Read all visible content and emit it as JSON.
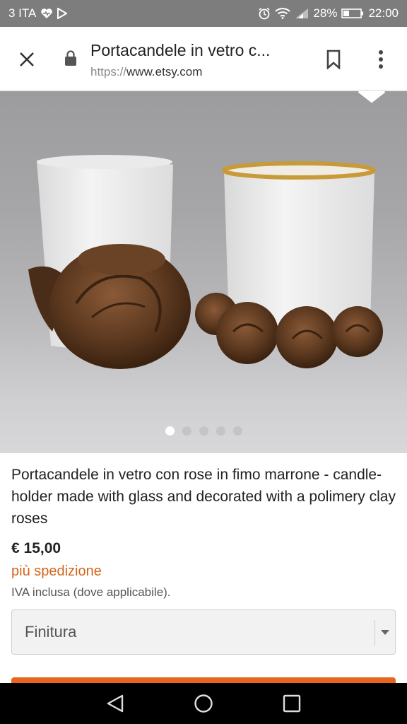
{
  "status_bar": {
    "carrier": "3 ITA",
    "battery": "28%",
    "time": "22:00"
  },
  "browser": {
    "page_title": "Portacandele in vetro c...",
    "url_scheme": "https://",
    "url_host": "www.etsy.com"
  },
  "gallery": {
    "image_count": 5,
    "active_index": 0
  },
  "product": {
    "title": "Portacandele in vetro con rose in fimo marrone - candle-holder made with glass and decorated with a polimery clay roses",
    "price": "€ 15,00",
    "shipping": "più spedizione",
    "vat_note": "IVA inclusa (dove applicabile).",
    "variant_select": {
      "selected": "Finitura"
    }
  },
  "colors": {
    "accent_orange": "#e8651f",
    "shipping_text": "#d5641c",
    "status_bar_bg": "#7d7d7d"
  }
}
